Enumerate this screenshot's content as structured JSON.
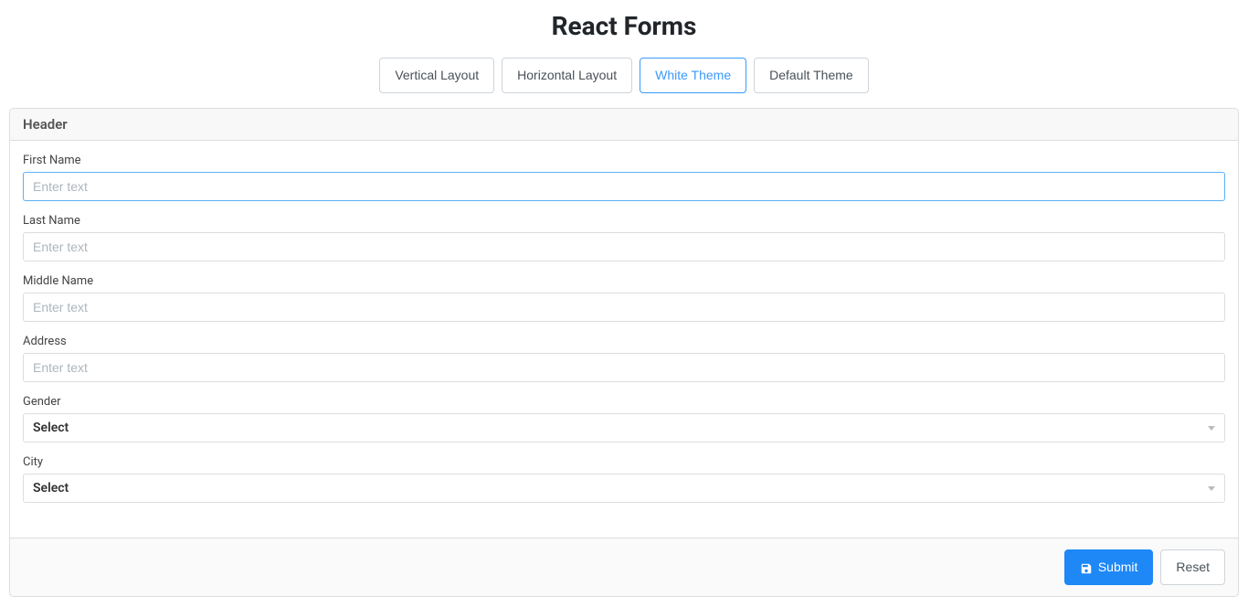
{
  "title": "React Forms",
  "layoutButtons": {
    "vertical": "Vertical Layout",
    "horizontal": "Horizontal Layout",
    "whiteTheme": "White Theme",
    "defaultTheme": "Default Theme"
  },
  "panel": {
    "header": "Header"
  },
  "fields": {
    "firstName": {
      "label": "First Name",
      "placeholder": "Enter text"
    },
    "lastName": {
      "label": "Last Name",
      "placeholder": "Enter text"
    },
    "middleName": {
      "label": "Middle Name",
      "placeholder": "Enter text"
    },
    "address": {
      "label": "Address",
      "placeholder": "Enter text"
    },
    "gender": {
      "label": "Gender",
      "selected": "Select"
    },
    "city": {
      "label": "City",
      "selected": "Select"
    }
  },
  "footer": {
    "submit": "Submit",
    "reset": "Reset"
  }
}
